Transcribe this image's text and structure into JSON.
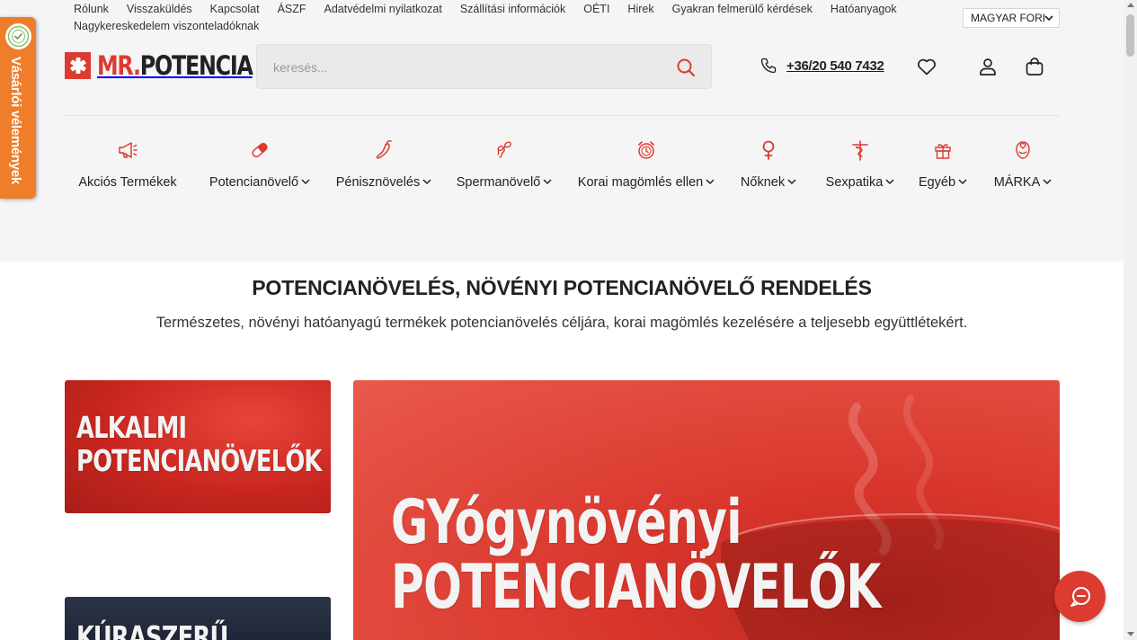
{
  "colors": {
    "brand": "#dc3b30",
    "side_tab": "#ef7d2a",
    "header_bg": "#f5f5f5"
  },
  "top_links": [
    {
      "label": "Rólunk"
    },
    {
      "label": "Visszaküldés"
    },
    {
      "label": "Kapcsolat"
    },
    {
      "label": "ÁSZF"
    },
    {
      "label": "Adatvédelmi nyilatkozat"
    },
    {
      "label": "Szállítási információk"
    },
    {
      "label": "OÉTI"
    },
    {
      "label": "Hirek"
    },
    {
      "label": "Gyakran felmerülő kérdések"
    },
    {
      "label": "Hatóanyagok"
    },
    {
      "label": "Nagykereskedelem viszonteladóknak"
    }
  ],
  "language": {
    "selected": "MAGYAR FORI"
  },
  "logo": {
    "mr": "MR.",
    "name": "POTENCIA"
  },
  "search": {
    "placeholder": "keresés...",
    "value": ""
  },
  "contact": {
    "phone": "+36/20 540 7432"
  },
  "header_icons": [
    "phone-icon",
    "heart-icon",
    "user-icon",
    "cart-icon"
  ],
  "nav": [
    {
      "label": "Akciós Termékek",
      "icon": "megaphone-icon",
      "dropdown": false
    },
    {
      "label": "Potencianövelő",
      "icon": "pill-icon",
      "dropdown": true
    },
    {
      "label": "Pénisznövelés",
      "icon": "chili-pepper-icon",
      "dropdown": true
    },
    {
      "label": "Spermanövelő",
      "icon": "sperm-icon",
      "dropdown": true
    },
    {
      "label": "Korai magömlés ellen",
      "icon": "alarm-clock-icon",
      "dropdown": true
    },
    {
      "label": "Nőknek",
      "icon": "female-symbol-icon",
      "dropdown": true
    },
    {
      "label": "Sexpatika",
      "icon": "caduceus-icon",
      "dropdown": true
    },
    {
      "label": "Egyéb",
      "icon": "gift-icon",
      "dropdown": true
    },
    {
      "label": "MÁRKA",
      "icon": "hand-heart-icon",
      "dropdown": true
    }
  ],
  "side_tab": {
    "label": "Vásárlói vélemények"
  },
  "main": {
    "heading": "POTENCIANÖVELÉS, NÖVÉNYI POTENCIANÖVELŐ RENDELÉS",
    "subheading": "Természetes, növényi hatóanyagú termékek potencianövelés céljára, korai magömlés kezelésére a teljesebb együttlétekért."
  },
  "banners": [
    {
      "line1": "ALKALMI",
      "line2": "POTENCIANÖVELŐK"
    },
    {
      "line1": "GYógynövényi",
      "line2": "POTENCIANÖVELŐK"
    },
    {
      "line1": "KÚRASZERŰ"
    }
  ]
}
